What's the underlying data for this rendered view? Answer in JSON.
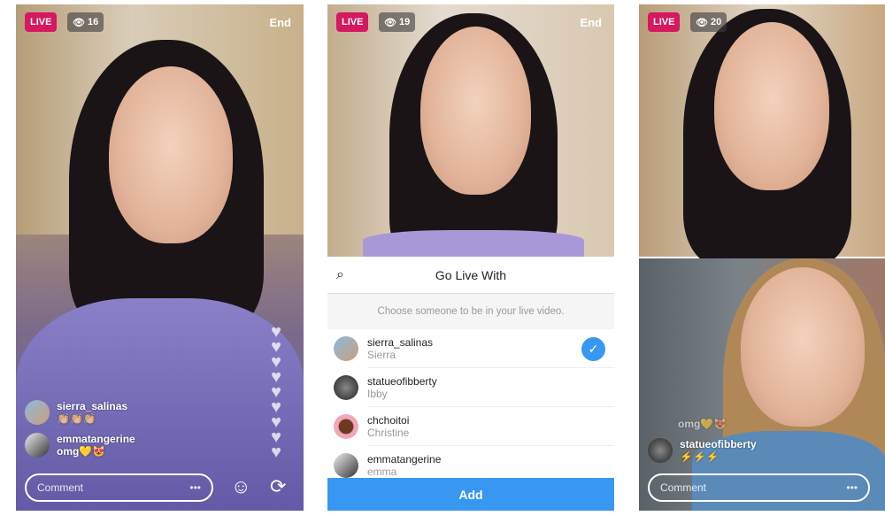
{
  "panels": [
    {
      "live": "LIVE",
      "viewers": "16",
      "end": "End",
      "comments": [
        {
          "user": "sierra_salinas",
          "text": "👏🏼👏🏼👏🏼"
        },
        {
          "user": "emmatangerine",
          "text": "omg💛😻"
        }
      ],
      "comment_placeholder": "Comment",
      "more": "•••"
    },
    {
      "live": "LIVE",
      "viewers": "19",
      "end": "End",
      "sheet": {
        "title": "Go Live With",
        "subtitle": "Choose someone to be in your live video.",
        "users": [
          {
            "username": "sierra_salinas",
            "name": "Sierra",
            "selected": true
          },
          {
            "username": "statueofibberty",
            "name": "Ibby"
          },
          {
            "username": "chchoitoi",
            "name": "Christine"
          },
          {
            "username": "emmatangerine",
            "name": "emma"
          }
        ],
        "add": "Add"
      }
    },
    {
      "live": "LIVE",
      "viewers": "20",
      "comments": [
        {
          "user": "",
          "text": "omg💛😻"
        },
        {
          "user": "statueofibberty",
          "text": "⚡⚡⚡"
        }
      ],
      "comment_placeholder": "Comment",
      "more": "•••"
    }
  ],
  "colors": {
    "live": "#d6185f",
    "accent": "#3897f0"
  }
}
